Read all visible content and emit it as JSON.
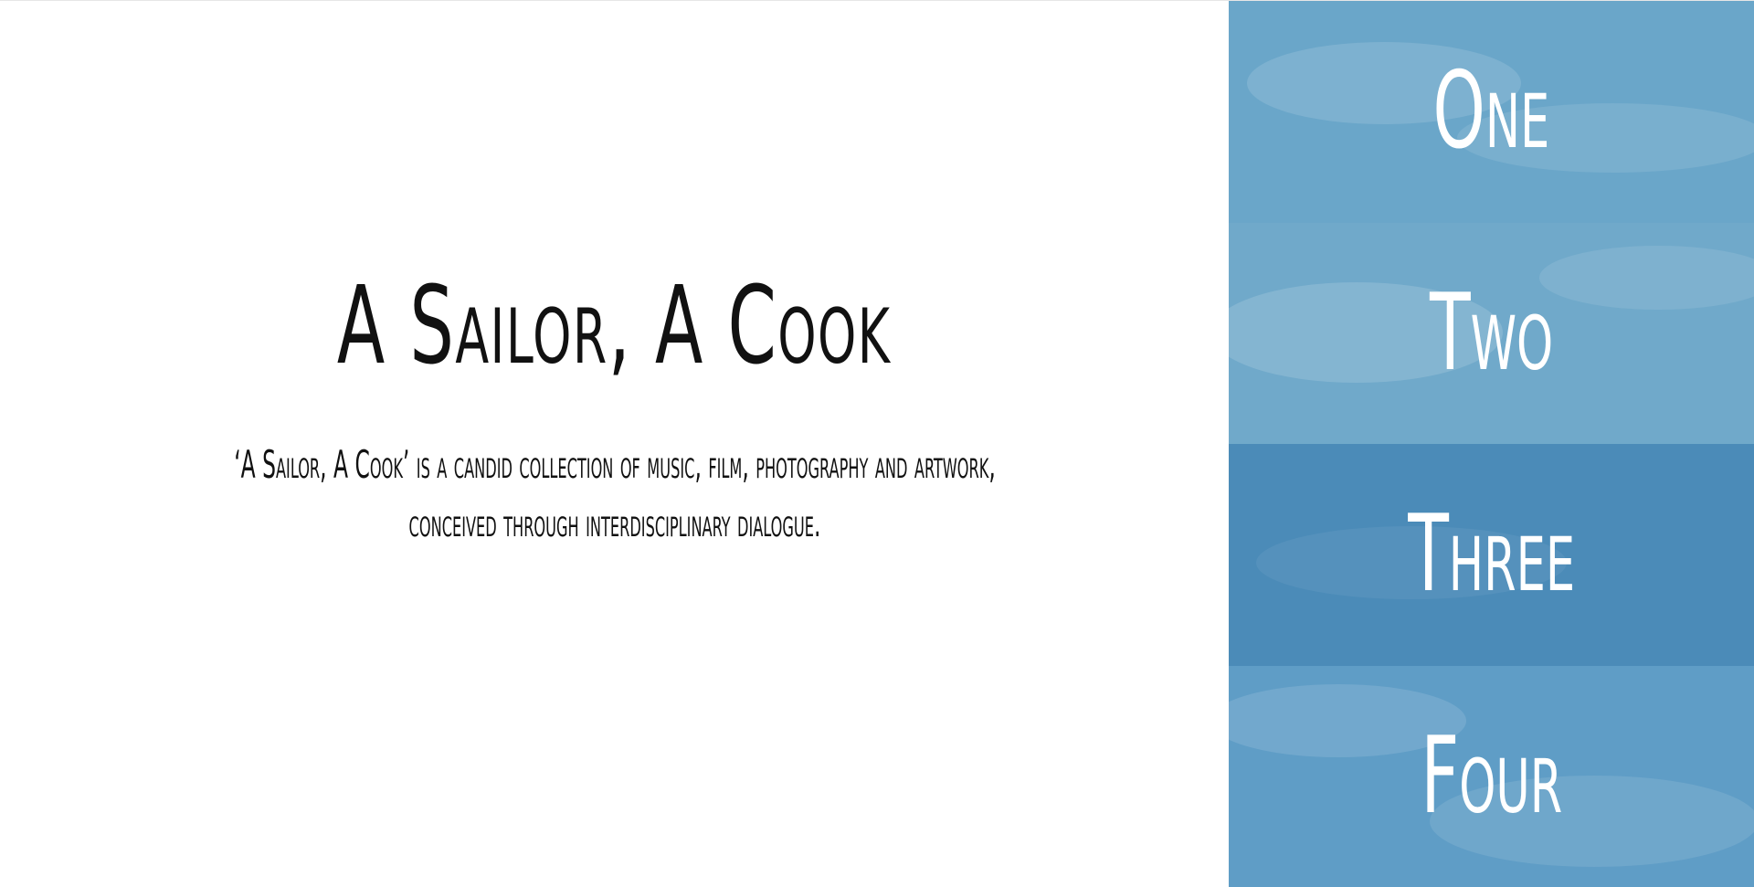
{
  "hero": {
    "title": "A Sailor, A Cook",
    "description_line1": "‘A Sailor, A Cook’ is a candid collection of music, film, photography and artwork,",
    "description_line2": "conceived through interdisciplinary dialogue."
  },
  "nav": {
    "items": [
      {
        "label": "One",
        "background": "#6aa6c9"
      },
      {
        "label": "Two",
        "background": "#70a9ca"
      },
      {
        "label": "Three",
        "background": "#4b8bb8"
      },
      {
        "label": "Four",
        "background": "#5f9dc6"
      }
    ]
  }
}
